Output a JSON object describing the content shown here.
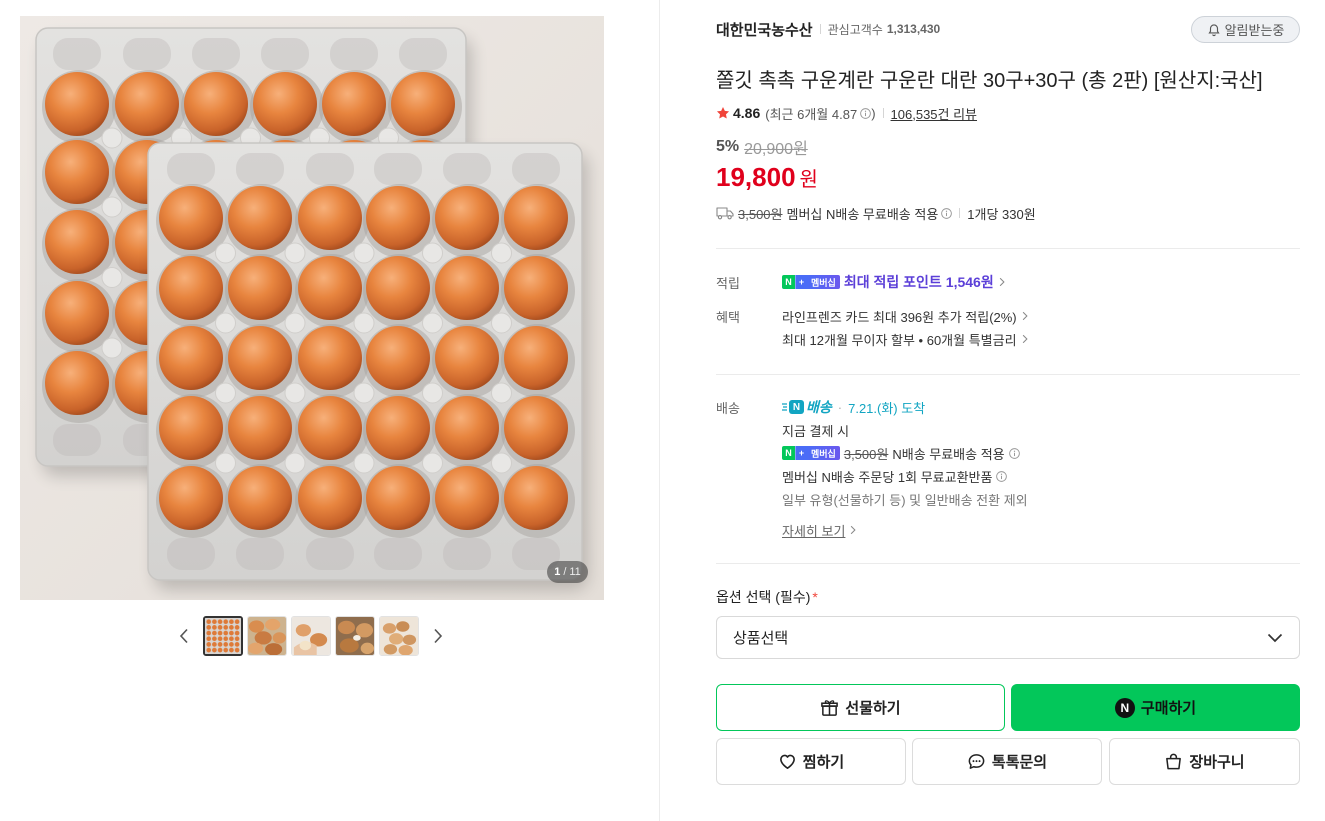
{
  "page": {
    "colors": {
      "accent_green": "#03c75a",
      "price_red": "#e0001c",
      "rating_star": "#f0443a",
      "reward_purple": "#5b3fd8",
      "delivery_teal": "#12a5c2",
      "membership_blue": "#4a6cf7"
    }
  },
  "gallery": {
    "counter_current": "1",
    "counter_separator": "/",
    "counter_total": "11",
    "prev_icon": "chevron-left-icon",
    "next_icon": "chevron-right-icon"
  },
  "seller": {
    "name": "대한민국농수산",
    "followers_label": "관심고객수",
    "followers_count": "1,313,430"
  },
  "alert_button": {
    "label": "알림받는중",
    "icon": "bell-icon"
  },
  "product": {
    "title": "쫄깃 촉촉 구운계란 구운란 대란 30구+30구 (총 2판) [원산지:국산]"
  },
  "rating": {
    "icon": "star-icon",
    "score": "4.86",
    "recent_open": "(최근 6개월 4.87",
    "recent_close": ")",
    "reviews": "106,535건 리뷰"
  },
  "price": {
    "discount_rate": "5%",
    "original": "20,900원",
    "sale": "19,800",
    "currency": "원"
  },
  "shipping_summary": {
    "icon": "truck-icon",
    "original_fee": "3,500원",
    "text": "멤버십 N배송 무료배송 적용",
    "unit_price": "1개당 330원"
  },
  "rewards": {
    "label": "적립",
    "badge_n": "N",
    "badge_plus": "+",
    "badge_member": "멤버십",
    "text": "최대 적립 포인트",
    "points": "1,546원"
  },
  "benefits": {
    "label": "혜택",
    "items": [
      "라인프렌즈 카드 최대 396원 추가 적립(2%)",
      "최대 12개월 무이자 할부 • 60개월 특별금리"
    ]
  },
  "delivery": {
    "label": "배송",
    "logo_n": "N",
    "logo_text": "배송",
    "dot": "·",
    "arrival": "7.21.(화) 도착",
    "pay_now": "지금 결제 시",
    "badge_n": "N",
    "badge_plus": "+",
    "badge_member": "멤버십",
    "fee_original": "3,500원",
    "fee_text": "N배송 무료배송 적용",
    "exchange": "멤버십 N배송 주문당 1회 무료교환반품",
    "exclusion": "일부 유형(선물하기 등) 및 일반배송 전환 제외",
    "details": "자세히 보기"
  },
  "options": {
    "label": "옵션 선택 (필수)",
    "required_mark": "*",
    "select_value": "상품선택",
    "select_icon": "chevron-down-icon"
  },
  "actions": {
    "gift": "선물하기",
    "buy": "구매하기",
    "buy_logo": "N",
    "wish": "찜하기",
    "talk": "톡톡문의",
    "cart": "장바구니"
  }
}
